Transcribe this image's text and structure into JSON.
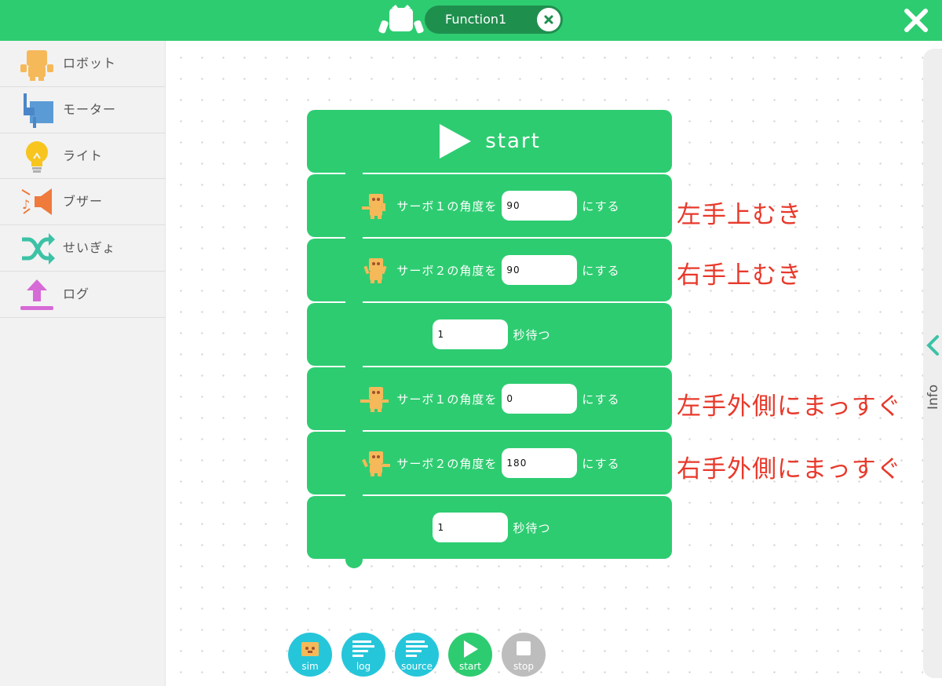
{
  "header": {
    "tab_label": "Function1"
  },
  "sidebar": {
    "items": [
      {
        "label": "ロボット"
      },
      {
        "label": "モーター"
      },
      {
        "label": "ライト"
      },
      {
        "label": "ブザー"
      },
      {
        "label": "せいぎょ"
      },
      {
        "label": "ログ"
      }
    ]
  },
  "blocks": {
    "start_label": "start",
    "servo1_label": "サーボ１の角度を",
    "servo2_label": "サーボ２の角度を",
    "set_suffix": "にする",
    "wait_suffix": "秒待つ",
    "values": [
      "90",
      "90",
      "1",
      "0",
      "180",
      "1"
    ]
  },
  "annotations": [
    "左手上むき",
    "右手上むき",
    "左手外側にまっすぐ",
    "右手外側にまっすぐ"
  ],
  "info_label": "Info",
  "toolbar": {
    "sim": "sim",
    "log": "log",
    "source": "source",
    "start": "start",
    "stop": "stop"
  },
  "colors": {
    "accent": "#2ecc71",
    "annotation": "#e8392b",
    "toolbar_blue": "#26c6da",
    "stop_gray": "#bdbdbd"
  }
}
